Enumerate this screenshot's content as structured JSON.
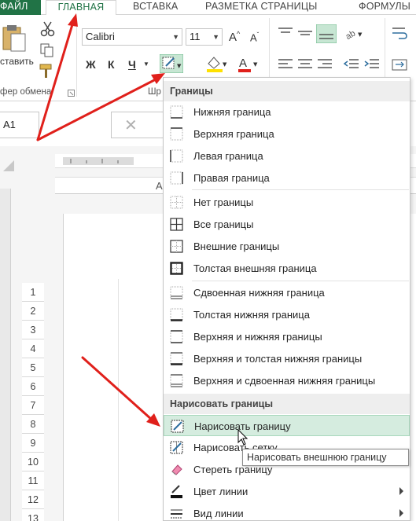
{
  "tabs": {
    "file": "ФАЙЛ",
    "home": "ГЛАВНАЯ",
    "insert": "ВСТАВКА",
    "page_layout": "РАЗМЕТКА СТРАНИЦЫ",
    "formulas": "ФОРМУЛЫ"
  },
  "ribbon": {
    "paste_label": "ставить",
    "clipboard_group": "фер обмена",
    "font_name": "Calibri",
    "font_size": "11",
    "font_group": "Шр",
    "bold": "Ж",
    "italic": "К",
    "underline": "Ч"
  },
  "formula_bar": {
    "name_box": "A1"
  },
  "sheet": {
    "column_header": "A",
    "rows": [
      "1",
      "2",
      "3",
      "4",
      "5",
      "6",
      "7",
      "8",
      "9",
      "10",
      "11",
      "12",
      "13"
    ]
  },
  "borders_menu": {
    "header_borders": "Границы",
    "items_borders": [
      {
        "label": "Нижняя граница",
        "icon": "bottom-border-icon"
      },
      {
        "label": "Верхняя граница",
        "icon": "top-border-icon"
      },
      {
        "label": "Левая граница",
        "icon": "left-border-icon"
      },
      {
        "label": "Правая граница",
        "icon": "right-border-icon"
      }
    ],
    "items_all": [
      {
        "label": "Нет границы",
        "icon": "no-border-icon"
      },
      {
        "label": "Все границы",
        "icon": "all-borders-icon"
      },
      {
        "label": "Внешние границы",
        "icon": "outside-borders-icon"
      },
      {
        "label": "Толстая внешняя граница",
        "icon": "thick-outside-border-icon"
      }
    ],
    "items_combo": [
      {
        "label": "Сдвоенная нижняя граница",
        "icon": "double-bottom-border-icon"
      },
      {
        "label": "Толстая нижняя граница",
        "icon": "thick-bottom-border-icon"
      },
      {
        "label": "Верхняя и нижняя границы",
        "icon": "top-bottom-border-icon"
      },
      {
        "label": "Верхняя и толстая нижняя границы",
        "icon": "top-thick-bottom-border-icon"
      },
      {
        "label": "Верхняя и сдвоенная нижняя границы",
        "icon": "top-double-bottom-border-icon"
      }
    ],
    "header_draw": "Нарисовать границы",
    "items_draw": [
      {
        "label": "Нарисовать границу",
        "icon": "draw-border-icon",
        "highlighted": true
      },
      {
        "label": "Нарисовать сетку",
        "icon": "draw-grid-icon"
      },
      {
        "label": "Стереть границу",
        "icon": "eraser-icon"
      },
      {
        "label": "Цвет линии",
        "icon": "line-color-icon",
        "submenu": true
      },
      {
        "label": "Вид линии",
        "icon": "line-style-icon",
        "submenu": true
      }
    ],
    "tooltip": "Нарисовать внешнюю границу"
  },
  "colors": {
    "excel_green": "#217346",
    "highlight": "#d5ecdf",
    "annotation_red": "#e0201b"
  }
}
